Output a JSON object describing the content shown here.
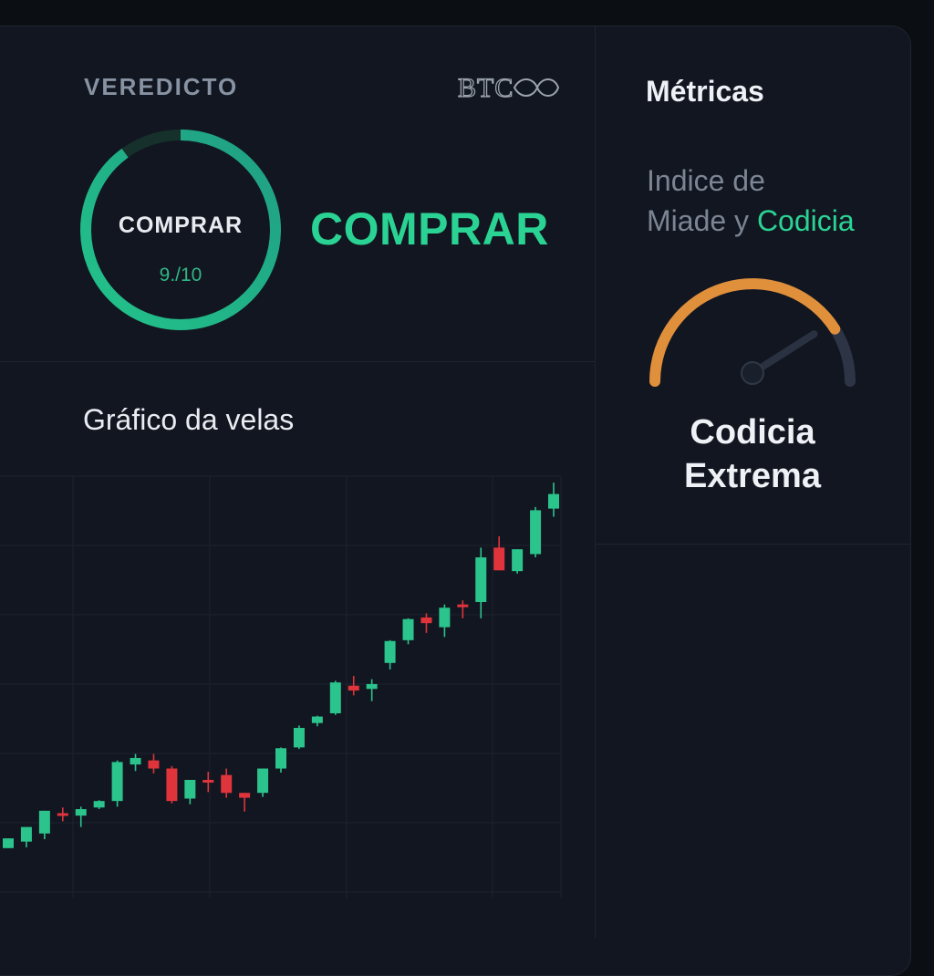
{
  "verdict": {
    "label": "VEREDICTO",
    "logo_text": "BTC",
    "ring_label": "COMPRAR",
    "score_text": "9./10",
    "score_value": 9,
    "score_max": 10,
    "big_label": "COMPRAR"
  },
  "chart_section": {
    "title": "Gráfico da velas"
  },
  "chart_data": {
    "type": "candlestick",
    "candles": [
      {
        "o": 62,
        "h": 48,
        "c": 74,
        "l": 80
      },
      {
        "o": 70,
        "h": 88,
        "c": 88,
        "l": 63
      },
      {
        "o": 80,
        "h": 102,
        "c": 108,
        "l": 73
      },
      {
        "o": 105,
        "h": 112,
        "c": 103,
        "l": 95
      },
      {
        "o": 102,
        "h": 113,
        "c": 110,
        "l": 88
      },
      {
        "o": 112,
        "h": 121,
        "c": 120,
        "l": 110
      },
      {
        "o": 120,
        "h": 170,
        "c": 168,
        "l": 113
      },
      {
        "o": 165,
        "h": 178,
        "c": 173,
        "l": 157
      },
      {
        "o": 170,
        "h": 178,
        "c": 160,
        "l": 154
      },
      {
        "o": 160,
        "h": 163,
        "c": 120,
        "l": 117
      },
      {
        "o": 123,
        "h": 146,
        "c": 146,
        "l": 116
      },
      {
        "o": 146,
        "h": 156,
        "c": 145,
        "l": 131
      },
      {
        "o": 152,
        "h": 160,
        "c": 130,
        "l": 124
      },
      {
        "o": 130,
        "h": 127,
        "c": 124,
        "l": 107
      },
      {
        "o": 130,
        "h": 160,
        "c": 160,
        "l": 125
      },
      {
        "o": 160,
        "h": 186,
        "c": 185,
        "l": 155
      },
      {
        "o": 186,
        "h": 213,
        "c": 210,
        "l": 184
      },
      {
        "o": 216,
        "h": 225,
        "c": 224,
        "l": 212
      },
      {
        "o": 228,
        "h": 268,
        "c": 266,
        "l": 226
      },
      {
        "o": 262,
        "h": 274,
        "c": 256,
        "l": 250
      },
      {
        "o": 258,
        "h": 270,
        "c": 264,
        "l": 243
      },
      {
        "o": 290,
        "h": 318,
        "c": 317,
        "l": 282
      },
      {
        "o": 318,
        "h": 345,
        "c": 344,
        "l": 313
      },
      {
        "o": 346,
        "h": 351,
        "c": 339,
        "l": 327
      },
      {
        "o": 334,
        "h": 362,
        "c": 358,
        "l": 322
      },
      {
        "o": 362,
        "h": 367,
        "c": 360,
        "l": 345
      },
      {
        "o": 365,
        "h": 432,
        "c": 420,
        "l": 345
      },
      {
        "o": 432,
        "h": 446,
        "c": 404,
        "l": 404
      },
      {
        "o": 403,
        "h": 426,
        "c": 430,
        "l": 400
      },
      {
        "o": 424,
        "h": 482,
        "c": 478,
        "l": 420
      },
      {
        "o": 480,
        "h": 512,
        "c": 498,
        "l": 470
      }
    ],
    "ylim": [
      0,
      520
    ],
    "grid": true
  },
  "metrics": {
    "title": "Métricas",
    "index_title_line1": "Indice de",
    "index_title_line2_a": "Miade y ",
    "index_title_line2_b": "Codicia",
    "gauge_level": 0.82,
    "value_line1": "Codicia",
    "value_line2": "Extrema"
  },
  "colors": {
    "up": "#2bc48c",
    "down": "#e0343c",
    "accent": "#2ad393",
    "gauge_orange": "#e08f3a",
    "gauge_track": "#2c3445"
  }
}
